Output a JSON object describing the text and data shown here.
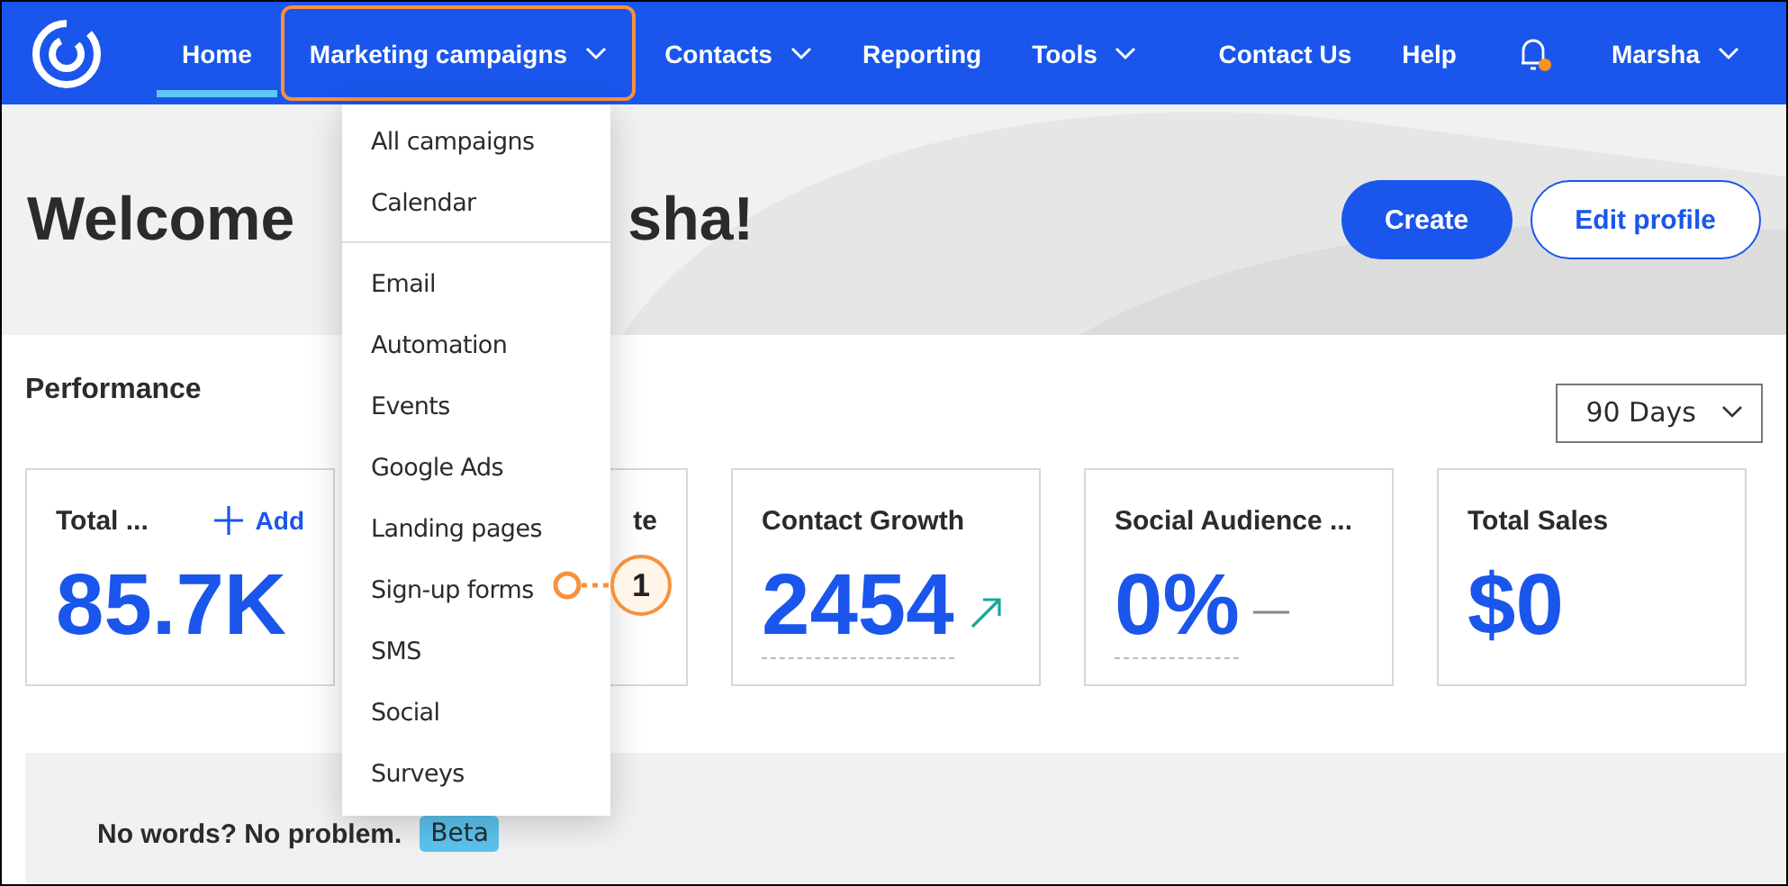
{
  "nav": {
    "items": [
      {
        "label": "Home",
        "selected": true,
        "highlighted": false,
        "dropdown": false
      },
      {
        "label": "Marketing campaigns",
        "selected": false,
        "highlighted": true,
        "dropdown": true
      },
      {
        "label": "Contacts",
        "selected": false,
        "highlighted": false,
        "dropdown": true
      },
      {
        "label": "Reporting",
        "selected": false,
        "highlighted": false,
        "dropdown": false
      },
      {
        "label": "Tools",
        "selected": false,
        "highlighted": false,
        "dropdown": true
      }
    ],
    "right_items": [
      {
        "label": "Contact Us"
      },
      {
        "label": "Help"
      }
    ],
    "notification_dot": true,
    "user": {
      "label": "Marsha"
    }
  },
  "hero": {
    "heading_start": "Welcome",
    "heading_end": "sha!",
    "buttons": [
      {
        "label": "Create",
        "kind": "primary"
      },
      {
        "label": "Edit profile",
        "kind": "outline"
      }
    ]
  },
  "performance": {
    "title": "Performance",
    "period": "90 Days",
    "cards": [
      {
        "title": "Total ...",
        "action": "Add",
        "value": "85.7K",
        "kind": "plain"
      },
      {
        "title": "te",
        "kind": "covered"
      },
      {
        "title": "Contact Growth",
        "value": "2454",
        "kind": "rising"
      },
      {
        "title": "Social Audience ...",
        "value": "0%",
        "kind": "steady"
      },
      {
        "title": "Total Sales",
        "value": "$0",
        "kind": "plain"
      }
    ]
  },
  "menu": {
    "groups": [
      [
        {
          "label": "All campaigns"
        },
        {
          "label": "Calendar"
        }
      ],
      [
        {
          "label": "Email"
        },
        {
          "label": "Automation"
        },
        {
          "label": "Events"
        },
        {
          "label": "Google Ads"
        },
        {
          "label": "Landing pages"
        },
        {
          "label": "Sign-up forms",
          "callout": "1"
        },
        {
          "label": "SMS"
        },
        {
          "label": "Social"
        },
        {
          "label": "Surveys"
        }
      ]
    ]
  },
  "banner": {
    "text": "No words? No problem.",
    "badge": "Beta"
  }
}
